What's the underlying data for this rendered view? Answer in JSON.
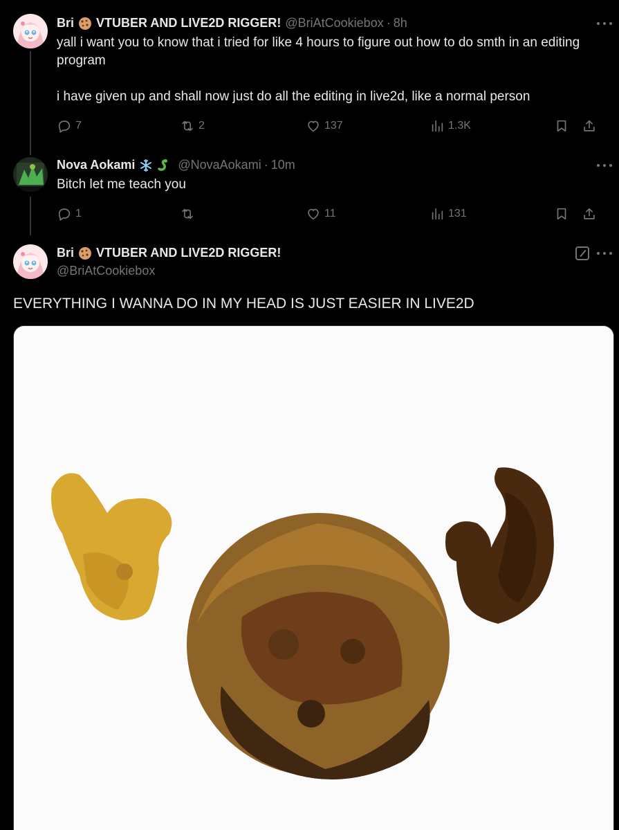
{
  "tweet1": {
    "name": "Bri",
    "name_suffix": "VTUBER AND LIVE2D RIGGER!",
    "handle": "@BriAtCookiebox",
    "dot": "·",
    "time": "8h",
    "text_line1": "yall i want you to know that i tried for like 4 hours to figure out how to do smth in an editing program",
    "text_line2": "i have given up and shall now just do all the editing in live2d, like a normal person",
    "replies": "7",
    "retweets": "2",
    "likes": "137",
    "views": "1.3K"
  },
  "tweet2": {
    "name": "Nova Aokami",
    "handle": "@NovaAokami",
    "dot": "·",
    "time": "10m",
    "text": "Bitch let me teach you",
    "replies": "1",
    "retweets": "",
    "likes": "11",
    "views": "131"
  },
  "tweet3": {
    "name": "Bri",
    "name_suffix": "VTUBER AND LIVE2D RIGGER!",
    "handle": "@BriAtCookiebox",
    "text": "EVERYTHING I WANNA DO IN MY HEAD IS JUST EASIER IN LIVE2D"
  },
  "colors": {
    "background": "#000000",
    "text_primary": "#e7e9ea",
    "text_secondary": "#71767b",
    "thread_line": "#333639"
  },
  "icons": [
    "cookie-emoji-icon",
    "snowflake-emoji-icon",
    "snake-emoji-icon",
    "reply-icon",
    "retweet-icon",
    "like-icon",
    "views-icon",
    "bookmark-icon",
    "share-icon",
    "more-icon",
    "grok-icon"
  ]
}
